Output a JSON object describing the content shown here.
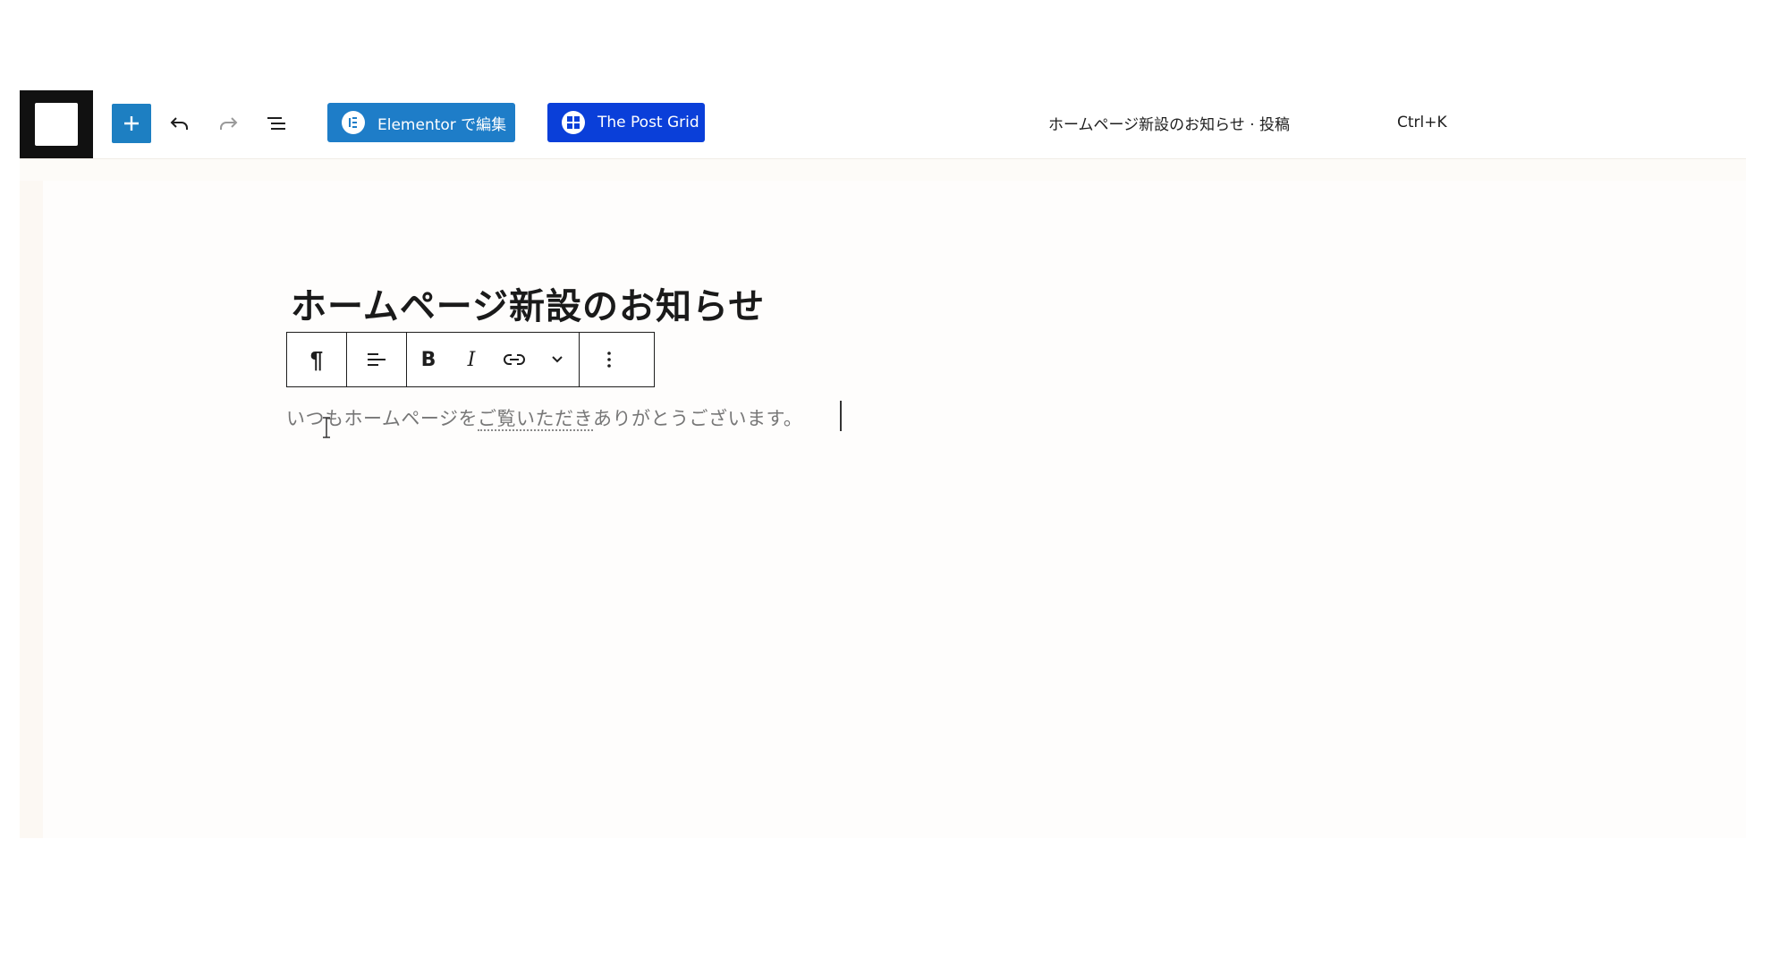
{
  "header": {
    "document_title": "ホームページ新設のお知らせ · 投稿",
    "shortcut_hint": "Ctrl+K",
    "plugins": {
      "elementor_label": "Elementor で編集",
      "postgrid_label": "The Post Grid"
    },
    "tools": {
      "add": "plus-icon",
      "undo": "undo-icon",
      "redo": "redo-icon",
      "outline": "list-view-icon"
    }
  },
  "block_toolbar": {
    "paragraph_icon": "¶",
    "bold_label": "B",
    "italic_label": "I"
  },
  "post": {
    "title": "ホームページ新設のお知らせ",
    "body_before": "いつもホームページを",
    "body_underlined": "ご覧いただき",
    "body_after": "ありがとうございます。"
  },
  "colors": {
    "primary_button": "#1d7fc2",
    "elementor": "#1e7dc8",
    "post_grid": "#0a3fd9"
  }
}
